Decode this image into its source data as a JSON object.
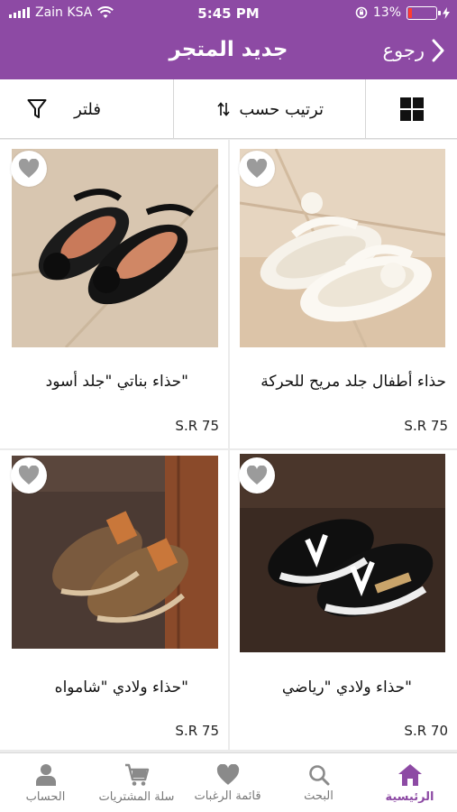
{
  "status_bar": {
    "carrier": "Zain KSA",
    "time": "5:45 PM",
    "battery": "13%",
    "battery_level": 0.13
  },
  "header": {
    "title": "جديد المتجر",
    "back_label": "رجوع"
  },
  "toolbar": {
    "filter_label": "فلتر",
    "sort_label": "ترتيب حسب"
  },
  "products": [
    {
      "name": "حذاء أطفال جلد مريح للحركة",
      "price": "S.R 75"
    },
    {
      "name": "حذاء بناتي \"جلد أسود\"",
      "price": "S.R 75"
    },
    {
      "name": "حذاء ولادي \"رياضي\"",
      "price": "S.R 70"
    },
    {
      "name": "حذاء ولادي \"شامواه\"",
      "price": "S.R 75"
    }
  ],
  "tabs": [
    {
      "label": "الرئيسية",
      "icon": "home-icon",
      "active": true
    },
    {
      "label": "البحث",
      "icon": "search-icon",
      "active": false
    },
    {
      "label": "قائمة الرغبات",
      "icon": "heart-icon",
      "active": false
    },
    {
      "label": "سلة المشتريات",
      "icon": "cart-icon",
      "active": false
    },
    {
      "label": "الحساب",
      "icon": "user-icon",
      "active": false
    }
  ],
  "colors": {
    "brand": "#8d4aa4",
    "battery_low": "#ff3b30",
    "inactive_icon": "#8a8a8a"
  }
}
